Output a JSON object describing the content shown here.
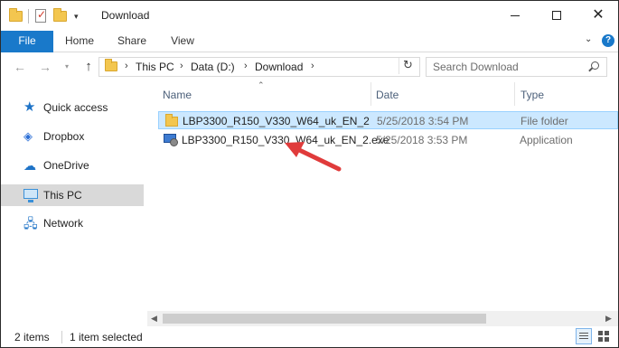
{
  "window": {
    "title": "Download",
    "controls": {
      "minimize": "minimize",
      "maximize": "maximize",
      "close": "✕"
    }
  },
  "ribbon": {
    "tabs": [
      {
        "label": "File",
        "active": true
      },
      {
        "label": "Home"
      },
      {
        "label": "Share"
      },
      {
        "label": "View"
      }
    ],
    "help_glyph": "?"
  },
  "address": {
    "breadcrumbs": [
      "This PC",
      "Data (D:)",
      "Download"
    ],
    "separator": "›"
  },
  "search": {
    "placeholder": "Search Download"
  },
  "sidebar": {
    "items": [
      {
        "label": "Quick access",
        "icon": "star-icon"
      },
      {
        "label": "Dropbox",
        "icon": "dropbox-icon"
      },
      {
        "label": "OneDrive",
        "icon": "cloud-icon"
      },
      {
        "label": "This PC",
        "icon": "computer-icon",
        "selected": true
      },
      {
        "label": "Network",
        "icon": "network-icon"
      }
    ]
  },
  "columns": {
    "name": "Name",
    "date": "Date",
    "type": "Type"
  },
  "files": [
    {
      "name": "LBP3300_R150_V330_W64_uk_EN_2",
      "date": "5/25/2018 3:54 PM",
      "type": "File folder",
      "icon": "folder-icon",
      "selected": true
    },
    {
      "name": "LBP3300_R150_V330_W64_uk_EN_2.exe",
      "date": "5/25/2018 3:53 PM",
      "type": "Application",
      "icon": "application-icon"
    }
  ],
  "status": {
    "item_count": "2 items",
    "selection": "1 item selected"
  },
  "colors": {
    "accent": "#1979ca",
    "selection": "#cce8ff",
    "arrow": "#e03b3b"
  }
}
